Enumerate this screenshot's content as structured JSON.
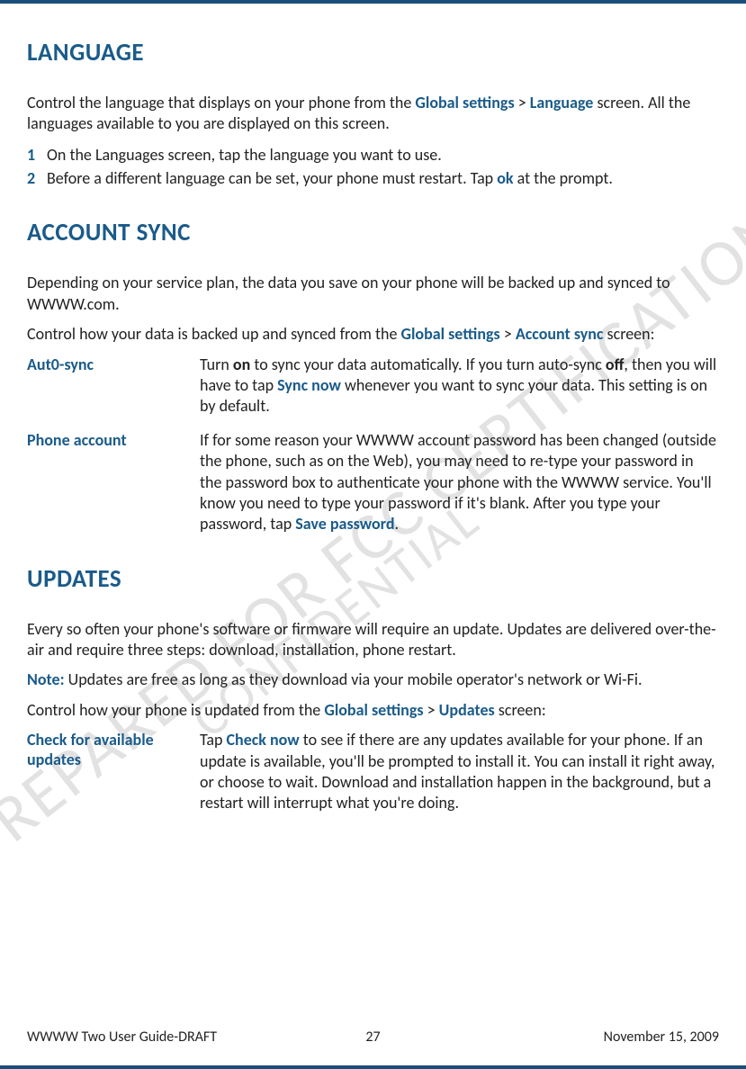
{
  "watermarks": {
    "line1": "PREPARED FOR FCC CERTIFICATION",
    "line2": "CONFIDENTIAL"
  },
  "sections": {
    "language": {
      "heading": "LANGUAGE",
      "intro_part1": "Control the language that displays on your phone from the ",
      "intro_link1": "Global settings",
      "intro_sep": " > ",
      "intro_link2": "Language",
      "intro_part2": " screen. All the languages available to you are displayed on this screen.",
      "steps": [
        {
          "num": "1",
          "text": "On the Languages screen, tap the language you want to use."
        },
        {
          "num": "2",
          "text_part1": "Before a different language can be set, your phone must restart. Tap ",
          "text_bold": "ok",
          "text_part2": " at the prompt."
        }
      ]
    },
    "account_sync": {
      "heading": "ACCOUNT SYNC",
      "para1": "Depending on your service plan, the data you save on your phone will be backed up and synced to WWWW.com.",
      "para2_part1": "Control how your data is backed up and synced from the ",
      "para2_link1": "Global settings",
      "para2_sep": " > ",
      "para2_link2": "Account sync",
      "para2_part2": " screen:",
      "rows": [
        {
          "term": "Aut0-sync",
          "desc_p1": "Turn ",
          "desc_b1": "on",
          "desc_p2": " to sync your data automatically. If you turn auto-sync ",
          "desc_b2": "off",
          "desc_p3": ", then you will have to tap ",
          "desc_link": "Sync now",
          "desc_p4": " whenever you want to sync your data. This setting is on by default."
        },
        {
          "term": "Phone account",
          "desc_p1": "If for some reason your WWWW account password has been changed (outside the phone, such as on the Web), you may need to re-type your password in the password box to authenticate your phone with the WWWW service. You'll know you need to type your password if it's blank. After you type your password, tap ",
          "desc_link": "Save password",
          "desc_p2": "."
        }
      ]
    },
    "updates": {
      "heading": "UPDATES",
      "para1": "Every so often your phone's software or firmware will require an update. Updates are delivered over-the-air and require three steps: download, installation, phone restart.",
      "note_label": "Note:",
      "note_text": " Updates are free as long as they download via your mobile operator's network or Wi-Fi.",
      "para3_part1": "Control how your phone is updated from the ",
      "para3_link1": "Global settings",
      "para3_sep": " > ",
      "para3_link2": "Updates",
      "para3_part2": " screen:",
      "rows": [
        {
          "term": "Check for available updates",
          "desc_p1": "Tap ",
          "desc_link": "Check now",
          "desc_p2": " to see if there are any updates available for your phone. If an update is available, you'll be prompted to install it. You can install it right away, or choose to wait. Download and installation happen in the background, but a restart will interrupt what you're doing."
        }
      ]
    }
  },
  "footer": {
    "left": "WWWW Two User Guide-DRAFT",
    "center": "27",
    "right": "November 15, 2009"
  }
}
